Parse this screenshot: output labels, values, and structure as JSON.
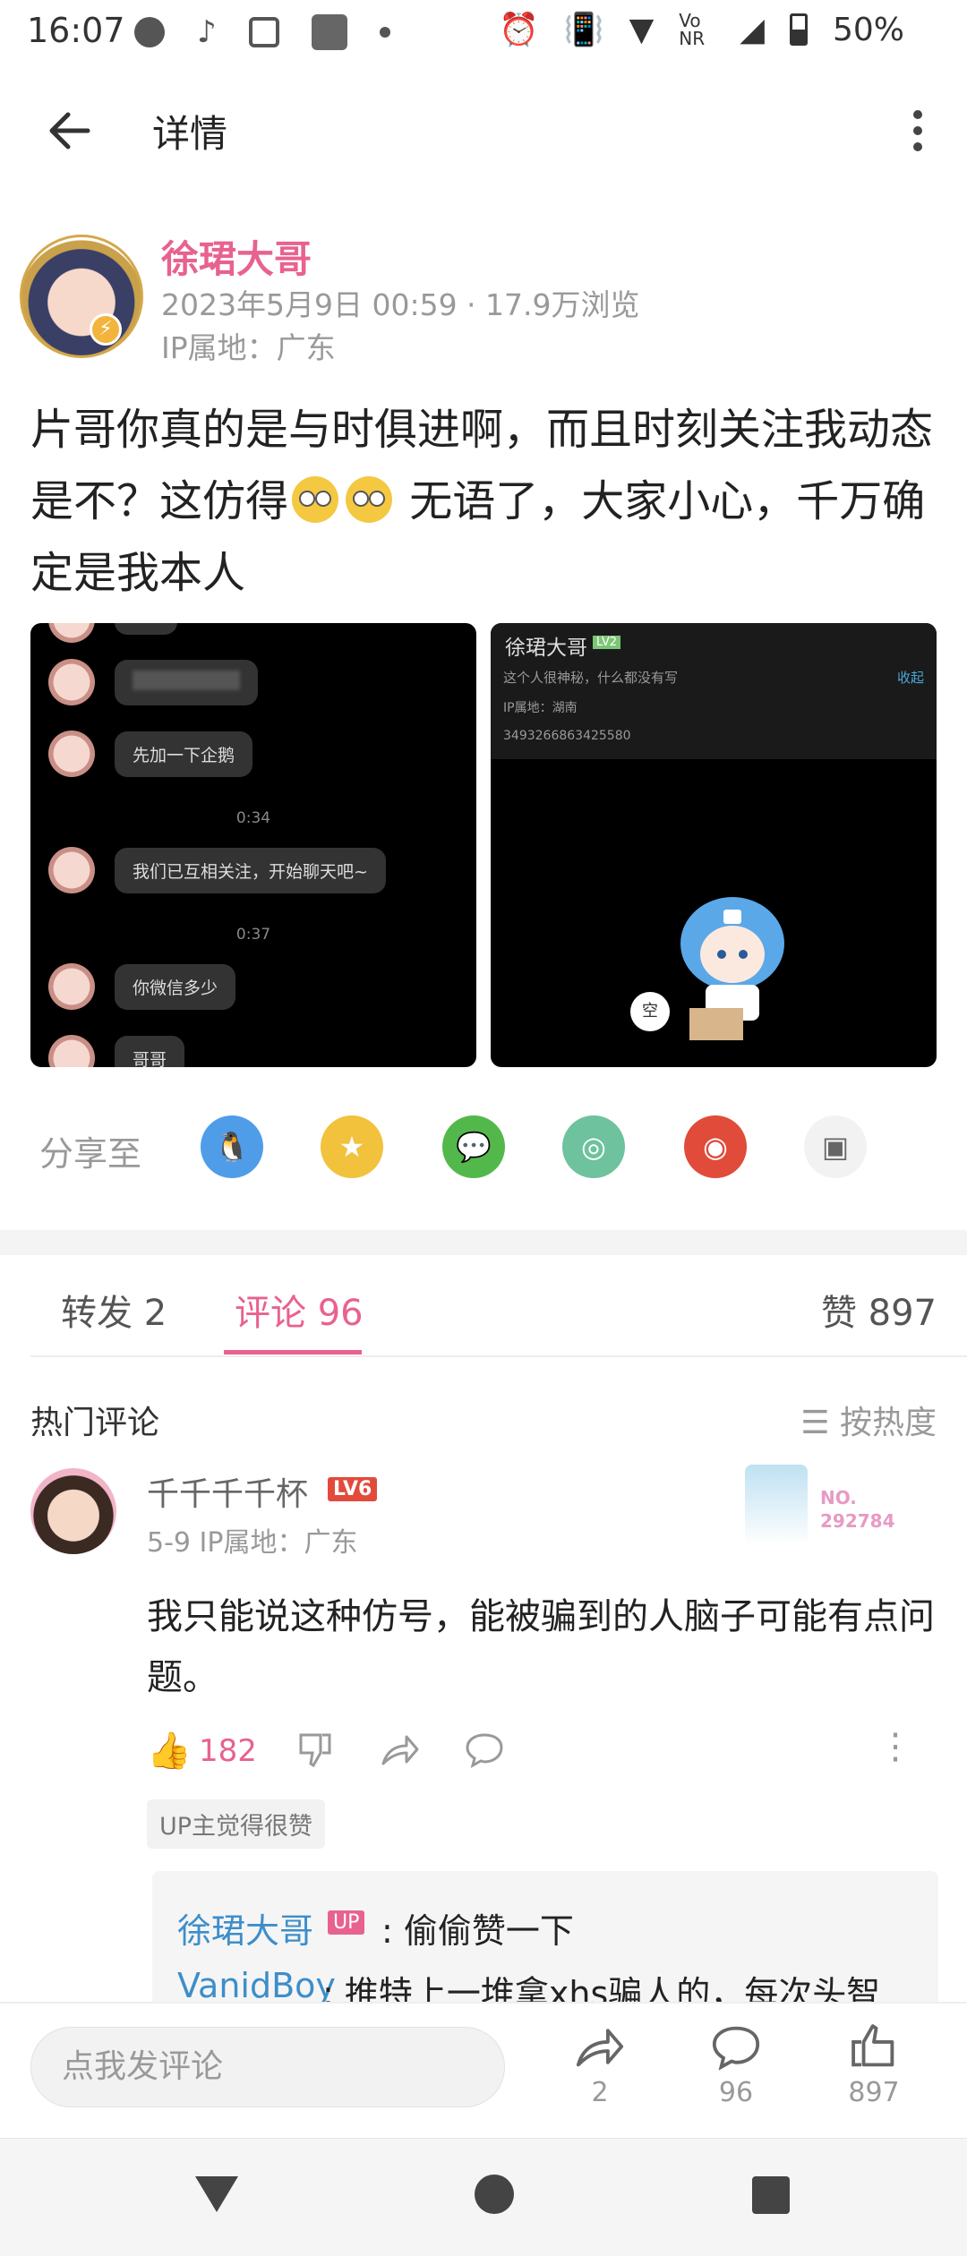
{
  "status_bar": {
    "time": "16:07",
    "network": "Vo NR",
    "battery": "50%",
    "icons": [
      "message-icon",
      "tiktok-icon",
      "calendar-icon",
      "app-icon",
      "dot-icon",
      "alarm-icon",
      "vibrate-icon",
      "wifi-icon",
      "volte-icon",
      "signal-icon",
      "battery-icon"
    ]
  },
  "header": {
    "title": "详情",
    "back_icon": "arrow-left-icon",
    "more_icon": "more-vertical-icon"
  },
  "post": {
    "author": "徐珺大哥",
    "date_views": "2023年5月9日 00:59 · 17.9万浏览",
    "ip": "IP属地：广东",
    "text_part1": "片哥你真的是与时俱进啊，而且时刻关注我动态是不？这仿得",
    "text_part2": " 无语了，大家小心，千万确定是我本人",
    "image1": {
      "bubbles": [
        "先加一下企鹅",
        "我们已互相关注，开始聊天吧~",
        "你微信多少",
        "哥哥"
      ],
      "times": [
        "0:34",
        "0:37"
      ]
    },
    "image2": {
      "name": "徐珺大哥",
      "level": "LV2",
      "desc": "这个人很神秘，什么都没有写",
      "collapse": "收起",
      "ip": "IP属地：湖南",
      "uid": "3493266863425580",
      "empty_label": "空"
    }
  },
  "share": {
    "label": "分享至",
    "targets": [
      "qq-icon",
      "qzone-icon",
      "wechat-icon",
      "moments-icon",
      "weibo-icon",
      "save-image-icon"
    ]
  },
  "tabs": {
    "repost": "转发 2",
    "comment": "评论 96",
    "like": "赞 897"
  },
  "comments": {
    "section_title": "热门评论",
    "sort": "☰ 按热度",
    "items": [
      {
        "user": "千千千千杯",
        "level": "LV6",
        "meta": "5-9  IP属地：广东",
        "fan_label": "NO.",
        "fan_number": "292784",
        "text": "我只能说这种仿号，能被骗到的人脑子可能有点问题。",
        "likes": "182",
        "up_tag": "UP主觉得很赞",
        "replies": [
          {
            "user": "徐珺大哥",
            "badge": "UP",
            "text": ": 偷偷赞一下"
          },
          {
            "user": "VanidBoy",
            "text": ": 推特上一堆拿xhs骗人的，每次头智"
          }
        ]
      }
    ]
  },
  "bottom_bar": {
    "input_placeholder": "点我发评论",
    "share_count": "2",
    "comment_count": "96",
    "like_count": "897"
  },
  "colors": {
    "accent": "#e8628f",
    "link": "#3d8ec9",
    "muted": "#999999"
  }
}
